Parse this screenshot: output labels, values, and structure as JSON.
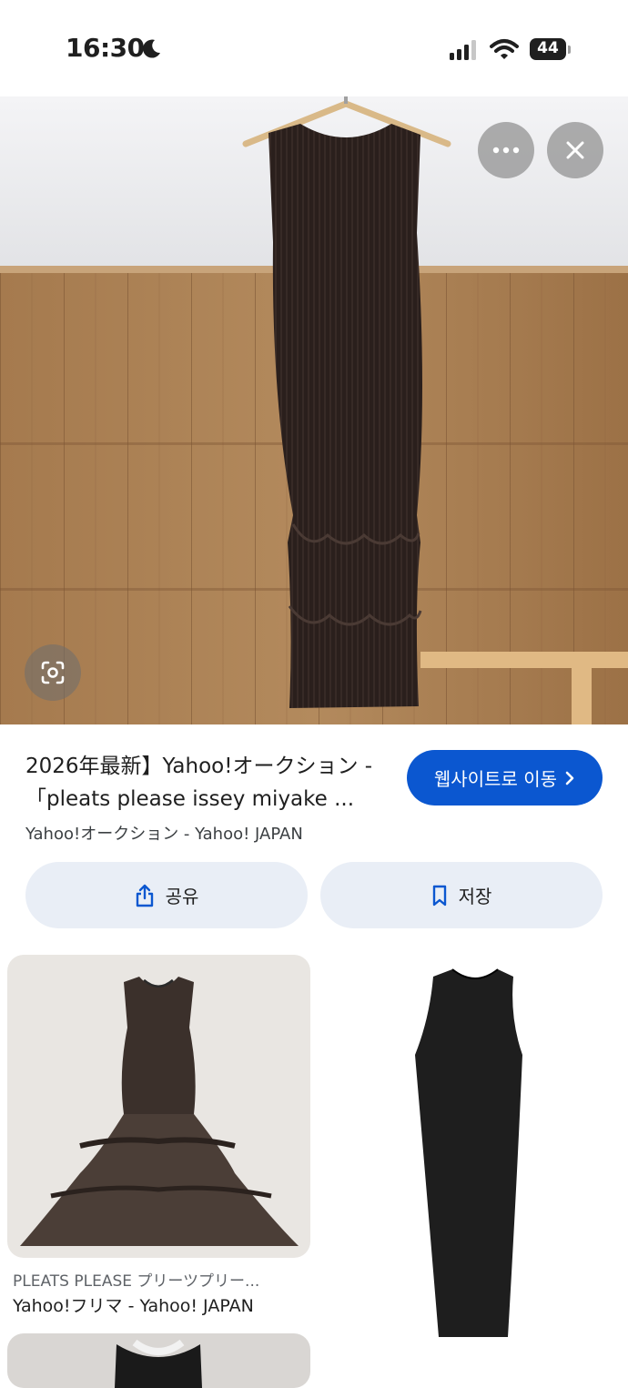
{
  "status_bar": {
    "time": "16:30",
    "battery": "44"
  },
  "hero": {
    "alt": "black pleated dress hanging on wooden wall"
  },
  "result": {
    "title_line1": "2026年最新】Yahoo!オークション -",
    "title_line2": "「pleats please issey miyake ...",
    "source": "Yahoo!オークション - Yahoo! JAPAN",
    "visit_label": "웹사이트로 이동",
    "share_label": "공유",
    "save_label": "저장"
  },
  "related": [
    {
      "caption": "PLEATS PLEASE プリーツプリー...",
      "source": "Yahoo!フリマ - Yahoo! JAPAN"
    }
  ],
  "colors": {
    "accent": "#0b57d0",
    "chip_bg": "#e9eef6"
  },
  "icons": {
    "more": "more-horiz-icon",
    "close": "close-icon",
    "lens": "lens-icon",
    "share": "share-icon",
    "save": "bookmark-icon"
  }
}
